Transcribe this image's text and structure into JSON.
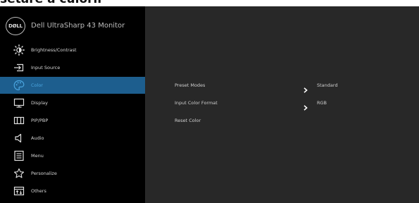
{
  "page": {
    "heading": "setare a culorii"
  },
  "osd": {
    "logo_text": "DØLL",
    "title": "Dell UltraSharp 43 Monitor"
  },
  "menu": {
    "items": [
      {
        "label": "Brightness/Contrast",
        "icon": "brightness-icon"
      },
      {
        "label": "Input Source",
        "icon": "input-source-icon"
      },
      {
        "label": "Color",
        "icon": "color-palette-icon",
        "selected": true
      },
      {
        "label": "Display",
        "icon": "display-icon"
      },
      {
        "label": "PIP/PBP",
        "icon": "pip-pbp-icon"
      },
      {
        "label": "Audio",
        "icon": "speaker-icon"
      },
      {
        "label": "Menu",
        "icon": "menu-list-icon"
      },
      {
        "label": "Personalize",
        "icon": "star-icon"
      },
      {
        "label": "Others",
        "icon": "others-icon"
      }
    ]
  },
  "submenu": {
    "items": [
      {
        "label": "Preset Modes",
        "value": "Standard",
        "has_arrow": true
      },
      {
        "label": "Input Color Format",
        "value": "RGB",
        "has_arrow": true
      },
      {
        "label": "Reset Color",
        "value": "",
        "has_arrow": false
      }
    ]
  },
  "colors": {
    "sidebar_bg": "#000000",
    "panel_bg": "#282828",
    "selected_bg": "#1d5e8e",
    "selected_text": "#4ba6e0",
    "text": "#d6d6d6"
  }
}
